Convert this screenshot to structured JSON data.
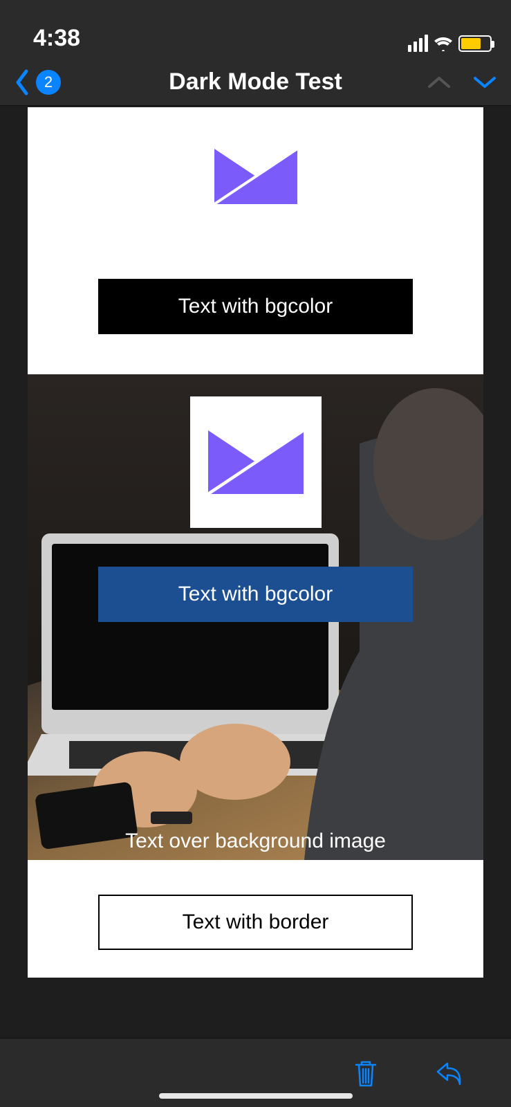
{
  "status": {
    "time": "4:38"
  },
  "nav": {
    "back_count": "2",
    "title": "Dark Mode Test"
  },
  "content": {
    "section_a_label": "Text with bgcolor",
    "section_b_label": "Text with bgcolor",
    "section_b_overlay": "Text over background image",
    "section_c_label": "Text with border"
  }
}
